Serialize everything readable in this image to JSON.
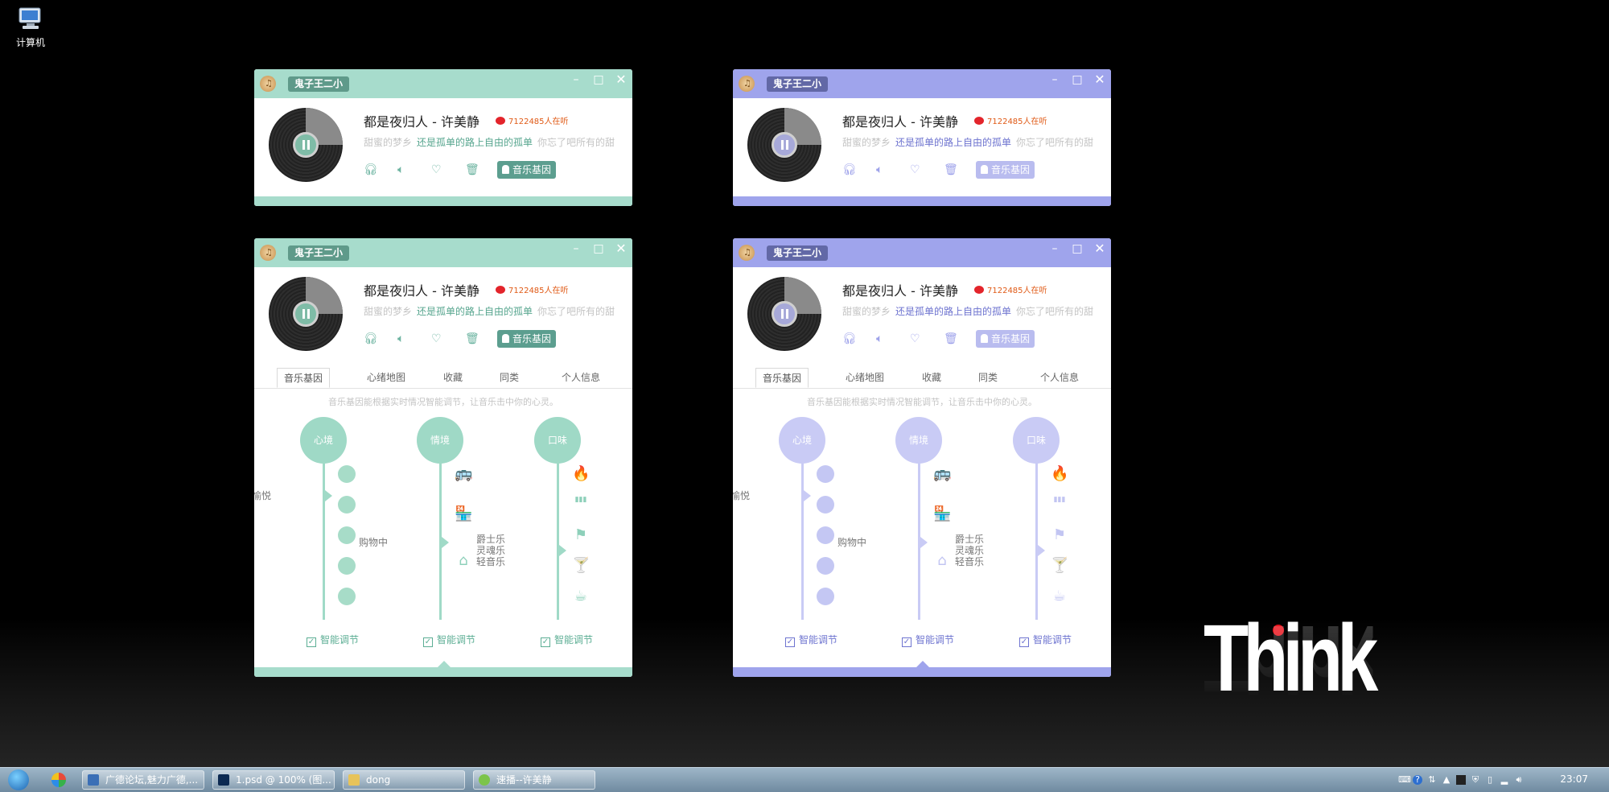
{
  "desktop": {
    "computer_label": "计算机"
  },
  "brand": {
    "think": "Think"
  },
  "windows": [
    {
      "theme": "green",
      "user": "鬼子王二小",
      "song": "都是夜归人 - 许美静",
      "listeners": "7122485人在听",
      "lyrics": {
        "prev": "甜蜜的梦乡",
        "current": "还是孤单的路上自由的孤单",
        "next": "你忘了吧所有的甜"
      },
      "gene_button": "音乐基因"
    },
    {
      "theme": "blue",
      "user": "鬼子王二小",
      "song": "都是夜归人 - 许美静",
      "listeners": "7122485人在听",
      "lyrics": {
        "prev": "甜蜜的梦乡",
        "current": "还是孤单的路上自由的孤单",
        "next": "你忘了吧所有的甜"
      },
      "gene_button": "音乐基因"
    },
    {
      "theme": "green",
      "user": "鬼子王二小",
      "song": "都是夜归人 - 许美静",
      "listeners": "7122485人在听",
      "lyrics": {
        "prev": "甜蜜的梦乡",
        "current": "还是孤单的路上自由的孤单",
        "next": "你忘了吧所有的甜"
      },
      "gene_button": "音乐基因",
      "tabs": [
        "音乐基因",
        "心绪地图",
        "收藏",
        "同类",
        "个人信息"
      ],
      "description": "音乐基因能根据实时情况智能调节，让音乐击中你的心灵。",
      "columns": [
        {
          "bubble": "心境",
          "label": "愉悦",
          "smart": "智能调节"
        },
        {
          "bubble": "情境",
          "label": "购物中",
          "smart": "智能调节"
        },
        {
          "bubble": "口味",
          "label": "爵士乐\n灵魂乐\n轻音乐",
          "smart": "智能调节"
        }
      ]
    },
    {
      "theme": "blue",
      "user": "鬼子王二小",
      "song": "都是夜归人 - 许美静",
      "listeners": "7122485人在听",
      "lyrics": {
        "prev": "甜蜜的梦乡",
        "current": "还是孤单的路上自由的孤单",
        "next": "你忘了吧所有的甜"
      },
      "gene_button": "音乐基因",
      "tabs": [
        "音乐基因",
        "心绪地图",
        "收藏",
        "同类",
        "个人信息"
      ],
      "description": "音乐基因能根据实时情况智能调节，让音乐击中你的心灵。",
      "columns": [
        {
          "bubble": "心境",
          "label": "愉悦",
          "smart": "智能调节"
        },
        {
          "bubble": "情境",
          "label": "购物中",
          "smart": "智能调节"
        },
        {
          "bubble": "口味",
          "label": "爵士乐\n灵魂乐\n轻音乐",
          "smart": "智能调节"
        }
      ]
    }
  ],
  "taskbar": {
    "buttons": [
      "广德论坛,魅力广德,...",
      "1.psd @ 100% (图...",
      "dong",
      "速播--许美静"
    ],
    "clock": "23:07"
  },
  "colors": {
    "green_theme": "#a7dccc",
    "blue_theme": "#9fa4ec",
    "accent_red": "#e8121b"
  },
  "icons": [
    "computer-icon",
    "app-music-icon",
    "minimize-icon",
    "maximize-icon",
    "close-icon",
    "play-pause-icon",
    "headphones-icon",
    "volume-icon",
    "heart-icon",
    "trash-icon",
    "person-icon",
    "weibo-icon",
    "bus-icon",
    "store-icon",
    "home-icon",
    "fire-icon",
    "bars-icon",
    "flag-icon",
    "cocktail-icon",
    "coffee-icon"
  ]
}
